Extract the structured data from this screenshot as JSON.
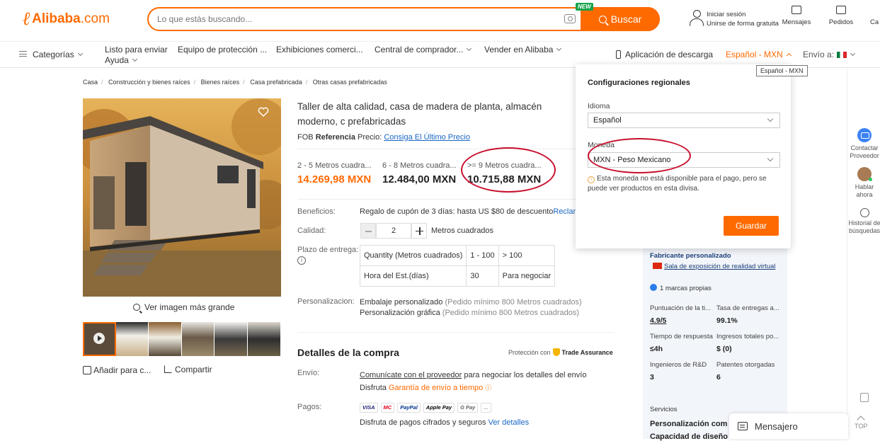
{
  "header": {
    "logo_text": "Alibaba",
    "logo_suffix": ".com",
    "search_placeholder": "Lo que estás buscando...",
    "new_badge": "NEW",
    "search_button": "Buscar",
    "sign_in": "Iniciar sesión",
    "register": "Unirse de forma gratuita",
    "messages": "Mensajes",
    "orders": "Pedidos",
    "cart": "Ca"
  },
  "nav": {
    "categories": "Categorías",
    "ready_to_ship": "Listo para enviar",
    "help": "Ayuda",
    "protection": "Equipo de protección ...",
    "exhibitions": "Exhibiciones comerci...",
    "buyer_central": "Central de comprador...",
    "sell": "Vender en Alibaba",
    "app_download": "Aplicación de descarga",
    "language_currency": "Español - MXN",
    "ship_to": "Envío a:"
  },
  "tooltip": "Español - MXN",
  "breadcrumb": [
    "Casa",
    "Construcción y bienes raíces",
    "Bienes raíces",
    "Casa prefabricada",
    "Otras casas prefabricadas"
  ],
  "gallery": {
    "view_larger": "Ver imagen más grande",
    "add_compare": "Añadir para c...",
    "share": "Compartir"
  },
  "product": {
    "title": "Taller de alta calidad, casa de madera de planta, almacén moderno, c prefabricadas",
    "fob_prefix": "FOB",
    "fob_bold": "Referencia",
    "fob_suffix": "Precio:",
    "fob_link": "Consiga El Último Precio",
    "price_tiers": [
      {
        "range": "2 - 5 Metros cuadra...",
        "price": "14.269,98 MXN"
      },
      {
        "range": "6 - 8 Metros cuadra...",
        "price": "12.484,00 MXN"
      },
      {
        "range": ">= 9 Metros cuadra...",
        "price": "10.715,88 MXN"
      }
    ],
    "benefits_label": "Beneficios:",
    "benefits_value": "Regalo de cupón de 3 días: hasta US $80 de descuento",
    "benefits_link": "Reclam",
    "quality_label": "Calidad:",
    "quantity": "2",
    "quantity_unit": "Metros cuadrados",
    "lead_label": "Plazo de entrega:",
    "lead_table": [
      [
        "Quantity (Metros cuadrados)",
        "1 - 100",
        "> 100"
      ],
      [
        "Hora del Est.(días)",
        "30",
        "Para negociar"
      ]
    ],
    "custom_label": "Personalizacion:",
    "custom_1": "Embalaje personalizado",
    "custom_1_note": "(Pedido mínimo 800 Metros cuadrados)",
    "custom_2": "Personalización gráfica",
    "custom_2_note": "(Pedido mínimo 800 Metros cuadrados)"
  },
  "purchase": {
    "title": "Detalles de la compra",
    "protection": "Protección con",
    "trade_assurance": "Trade Assurance",
    "shipping_label": "Envío:",
    "shipping_link": "Comunícate con el proveedor",
    "shipping_text": "para negociar los detalles del envío",
    "shipping_enjoy": "Disfruta",
    "shipping_guarantee": "Garantía de envío a tiempo",
    "payment_label": "Pagos:",
    "payment_methods": [
      "VISA",
      "MC",
      "PayPal",
      "Apple Pay",
      "G Pay",
      "..."
    ],
    "payment_note": "Disfruta de pagos cifrados y seguros",
    "payment_link": "Ver detalles"
  },
  "supplier": {
    "type": "Fabricante personalizado",
    "location": "Sala de exposición de realidad virtual",
    "own_brands": "1 marcas propias",
    "stats": [
      {
        "label": "Puntuación de la ti...",
        "value": "4.9/5"
      },
      {
        "label": "Tasa de entregas a...",
        "value": "99.1%"
      },
      {
        "label": "Tiempo de respuesta",
        "value": "≤4h"
      },
      {
        "label": "Ingresos totales po...",
        "value": "$ (0)"
      },
      {
        "label": "Ingenieros de R&D",
        "value": "3"
      },
      {
        "label": "Patentes otorgadas",
        "value": "6"
      }
    ],
    "services_label": "Servicios",
    "services_1": "Personalización com",
    "services_2": "Capacidad de diseño"
  },
  "rail": {
    "contact": "Contactar Proveedor",
    "chat": "Hablar ahora",
    "history": "Historial de búsquedas",
    "top": "TOP"
  },
  "messenger": "Mensajero",
  "region_popup": {
    "title": "Configuraciones regionales",
    "language_label": "Idioma",
    "language_value": "Español",
    "currency_label": "Moneda",
    "currency_value": "MXN - Peso Mexicano",
    "warning": "Esta moneda no está disponible para el pago, pero se puede ver productos en esta divisa.",
    "save": "Guardar"
  },
  "colors": {
    "brand": "#ff6a00",
    "link": "#1a66c4",
    "annotation": "#c8102e"
  }
}
